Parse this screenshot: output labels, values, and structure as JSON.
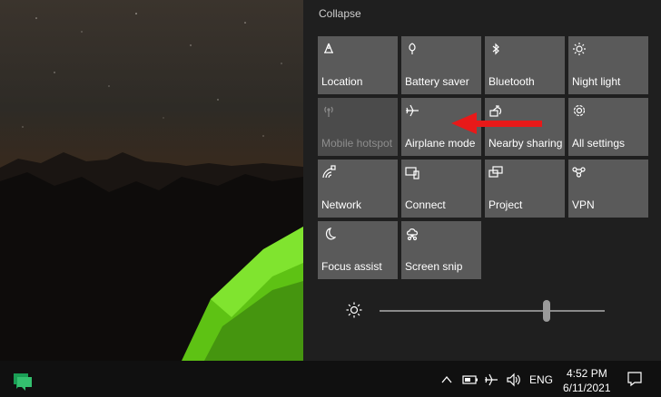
{
  "action_center": {
    "collapse_label": "Collapse",
    "tiles": [
      {
        "label": "Location",
        "icon": "location-icon",
        "active": true
      },
      {
        "label": "Battery saver",
        "icon": "battery-saver-icon",
        "active": true
      },
      {
        "label": "Bluetooth",
        "icon": "bluetooth-icon",
        "active": true
      },
      {
        "label": "Night light",
        "icon": "night-light-icon",
        "active": true
      },
      {
        "label": "Mobile hotspot",
        "icon": "mobile-hotspot-icon",
        "active": false
      },
      {
        "label": "Airplane mode",
        "icon": "airplane-icon",
        "active": true
      },
      {
        "label": "Nearby sharing",
        "icon": "nearby-sharing-icon",
        "active": true
      },
      {
        "label": "All settings",
        "icon": "gear-icon",
        "active": true
      },
      {
        "label": "Network",
        "icon": "network-icon",
        "active": true
      },
      {
        "label": "Connect",
        "icon": "connect-icon",
        "active": true
      },
      {
        "label": "Project",
        "icon": "project-icon",
        "active": true
      },
      {
        "label": "VPN",
        "icon": "vpn-icon",
        "active": true
      },
      {
        "label": "Focus assist",
        "icon": "moon-icon",
        "active": true
      },
      {
        "label": "Screen snip",
        "icon": "screen-snip-icon",
        "active": true
      }
    ],
    "brightness": {
      "value_fraction": 0.74
    }
  },
  "taskbar": {
    "language": "ENG",
    "time": "4:52 PM",
    "date": "6/11/2021"
  },
  "colors": {
    "tile": "#5a5a5a",
    "tile_dim": "#4b4b4b",
    "arrow": "#e81919",
    "tent": "#6edb1a",
    "chat_app": "#1a9e55"
  }
}
